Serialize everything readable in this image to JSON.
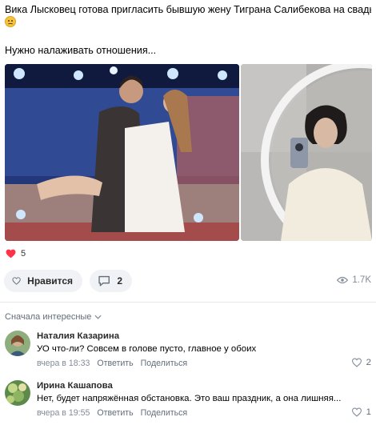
{
  "post": {
    "line1": "Вика Лысковец готова пригласить бывшую жену Тиграна Салибекова на свадьбу...",
    "emoji": "grimacing-face-emoji",
    "line2": "Нужно налаживать отношения..."
  },
  "reactions": {
    "count": "5"
  },
  "actions": {
    "like_label": "Нравится",
    "comment_count": "2",
    "views": "1.7K"
  },
  "comments_sort": {
    "label": "Сначала интересные"
  },
  "comments": [
    {
      "name": "Наталия Казарина",
      "text": "УО что-ли? Совсем в голове пусто, главное у обоих",
      "time": "вчера в 18:33",
      "reply": "Ответить",
      "share": "Поделиться",
      "likes": "2"
    },
    {
      "name": "Ирина Кашапова",
      "text": "Нет, будет напряжённая обстановка. Это ваш праздник, а она лишняя...",
      "time": "вчера в 19:55",
      "reply": "Ответить",
      "share": "Поделиться",
      "likes": "1"
    }
  ],
  "colors": {
    "accent_red": "#ff3347",
    "button_bg": "#f0f2f5",
    "secondary_text": "#818c99"
  }
}
